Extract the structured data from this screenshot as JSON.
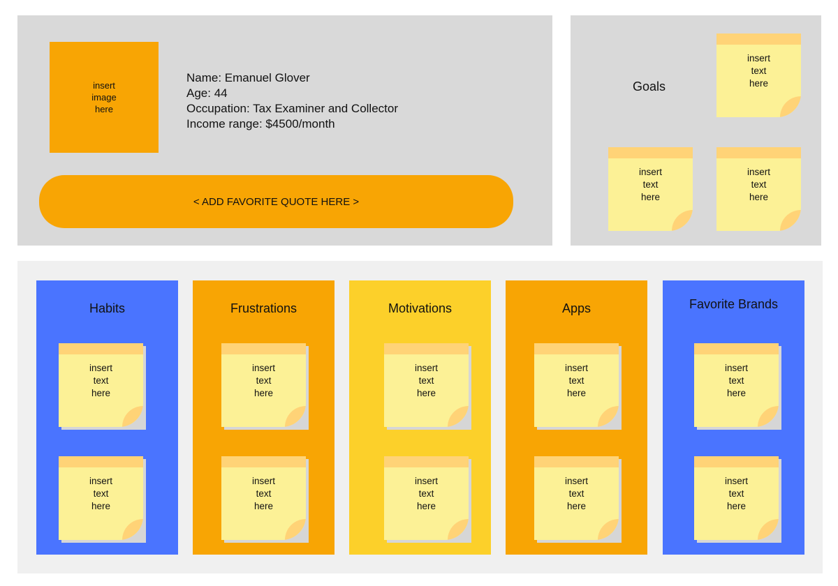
{
  "colors": {
    "panel_gray": "#d9d9d9",
    "lower_panel_gray": "#f0f0f0",
    "orange": "#f8a504",
    "blue": "#4a74ff",
    "yellow": "#fcd02a",
    "sticky_yellow": "#fcf196",
    "sticky_band": "#ffd377"
  },
  "profile": {
    "photo_placeholder": "insert\nimage\nhere",
    "name_line": "Name: Emanuel Glover",
    "age_line": "Age: 44",
    "occupation_line": "Occupation: Tax Examiner and Collector",
    "income_line": "Income range: $4500/month",
    "quote_placeholder": "< ADD FAVORITE QUOTE HERE >"
  },
  "goals": {
    "title": "Goals",
    "notes": [
      "insert\ntext\nhere",
      "insert\ntext\nhere",
      "insert\ntext\nhere"
    ]
  },
  "categories": [
    {
      "title": "Habits",
      "color": "#4a74ff",
      "notes": [
        "insert\ntext\nhere",
        "insert\ntext\nhere"
      ]
    },
    {
      "title": "Frustrations",
      "color": "#f8a504",
      "notes": [
        "insert\ntext\nhere",
        "insert\ntext\nhere"
      ]
    },
    {
      "title": "Motivations",
      "color": "#fcd02a",
      "notes": [
        "insert\ntext\nhere",
        "insert\ntext\nhere"
      ]
    },
    {
      "title": "Apps",
      "color": "#f8a504",
      "notes": [
        "insert\ntext\nhere",
        "insert\ntext\nhere"
      ]
    },
    {
      "title": "Favorite Brands",
      "color": "#4a74ff",
      "notes": [
        "insert\ntext\nhere",
        "insert\ntext\nhere"
      ]
    }
  ]
}
